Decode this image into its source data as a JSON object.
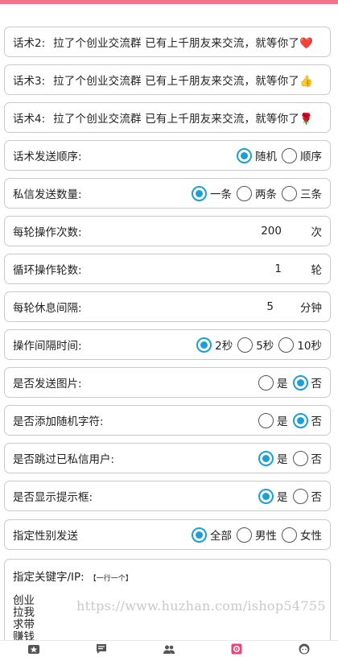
{
  "scripts": [
    {
      "label": "话术2:",
      "text": "拉了个创业交流群  已有上千朋友来交流，就等你了",
      "emoji": "❤️"
    },
    {
      "label": "话术3:",
      "text": "拉了个创业交流群  已有上千朋友来交流，就等你了",
      "emoji": "👍"
    },
    {
      "label": "话术4:",
      "text": "拉了个创业交流群  已有上千朋友来交流，就等你了",
      "emoji": "🌹"
    }
  ],
  "send_order": {
    "label": "话术发送顺序:",
    "options": [
      "随机",
      "顺序"
    ],
    "selected": 0
  },
  "dm_count": {
    "label": "私信发送数量:",
    "options": [
      "一条",
      "两条",
      "三条"
    ],
    "selected": 0
  },
  "ops_per_round": {
    "label": "每轮操作次数:",
    "value": "200",
    "unit": "次"
  },
  "loop_rounds": {
    "label": "循环操作轮数:",
    "value": "1",
    "unit": "轮"
  },
  "round_rest": {
    "label": "每轮休息间隔:",
    "value": "5",
    "unit": "分钟"
  },
  "op_interval": {
    "label": "操作间隔时间:",
    "options": [
      "2秒",
      "5秒",
      "10秒"
    ],
    "selected": 0
  },
  "send_image": {
    "label": "是否发送图片:",
    "options": [
      "是",
      "否"
    ],
    "selected": 1
  },
  "random_chars": {
    "label": "是否添加随机字符:",
    "options": [
      "是",
      "否"
    ],
    "selected": 1
  },
  "skip_messaged": {
    "label": "是否跳过已私信用户:",
    "options": [
      "是",
      "否"
    ],
    "selected": 0
  },
  "show_tip": {
    "label": "是否显示提示框:",
    "options": [
      "是",
      "否"
    ],
    "selected": 0
  },
  "gender": {
    "label": "指定性别发送",
    "options": [
      "全部",
      "男性",
      "女性"
    ],
    "selected": 0
  },
  "keywords": {
    "label": "指定关键字/IP:",
    "hint": "【一行一个】",
    "lines": [
      "创业",
      "拉我",
      "求带",
      "赚钱"
    ]
  },
  "watermark": "https://www.huzhan.com/ishop54755",
  "bottom_nav": [
    "star-icon",
    "message-icon",
    "users-icon",
    "settings-icon",
    "face-icon"
  ],
  "colors": {
    "accent": "#1a9fd9",
    "top_bar": "#f2728c",
    "active_nav": "#e8477a"
  }
}
